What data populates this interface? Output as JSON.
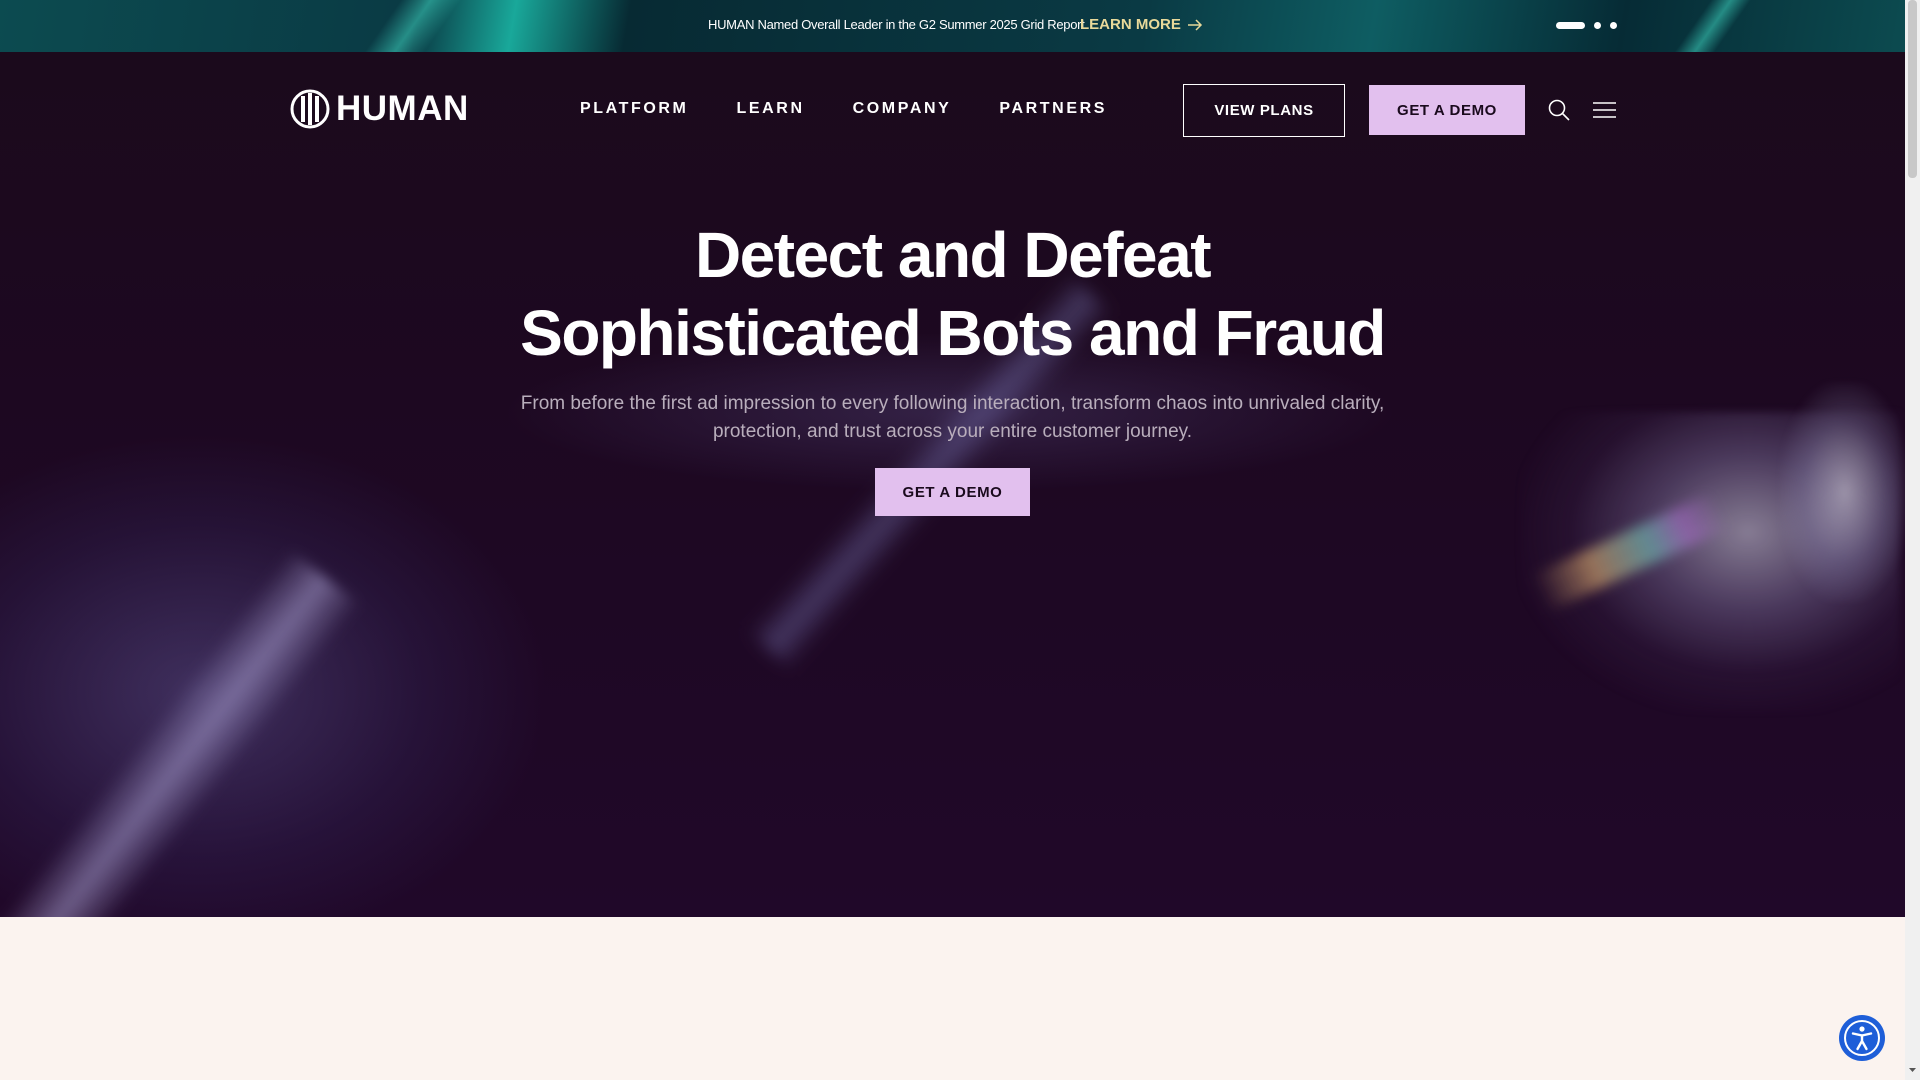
{
  "announcement": {
    "text": "HUMAN Named Overall Leader in the G2 Summer 2025 Grid Report",
    "link_label": "LEARN MORE",
    "active_slide": 1,
    "slide_count": 3
  },
  "header": {
    "logo_text": "HUMAN",
    "nav": [
      "PLATFORM",
      "LEARN",
      "COMPANY",
      "PARTNERS"
    ],
    "view_plans_label": "VIEW PLANS",
    "demo_label": "GET A DEMO"
  },
  "hero": {
    "headline_line1": "Detect and Defeat",
    "headline_line2": "Sophisticated Bots and Fraud",
    "subtext": "From before the first ad impression to every following interaction, transform chaos into unrivaled clarity, protection, and trust across your entire customer journey.",
    "cta_label": "GET A DEMO"
  },
  "icons": {
    "search": "search-icon",
    "menu": "hamburger-menu-icon",
    "accessibility": "accessibility-icon",
    "arrow": "arrow-right-icon",
    "logo": "human-logo-icon"
  },
  "colors": {
    "hero_bg": "#1d0821",
    "accent_button": "#e2c0ee",
    "announcement_link": "#e8d99a",
    "cream_bg": "#fbf3ef",
    "accessibility_bg": "#1e5ed8"
  }
}
